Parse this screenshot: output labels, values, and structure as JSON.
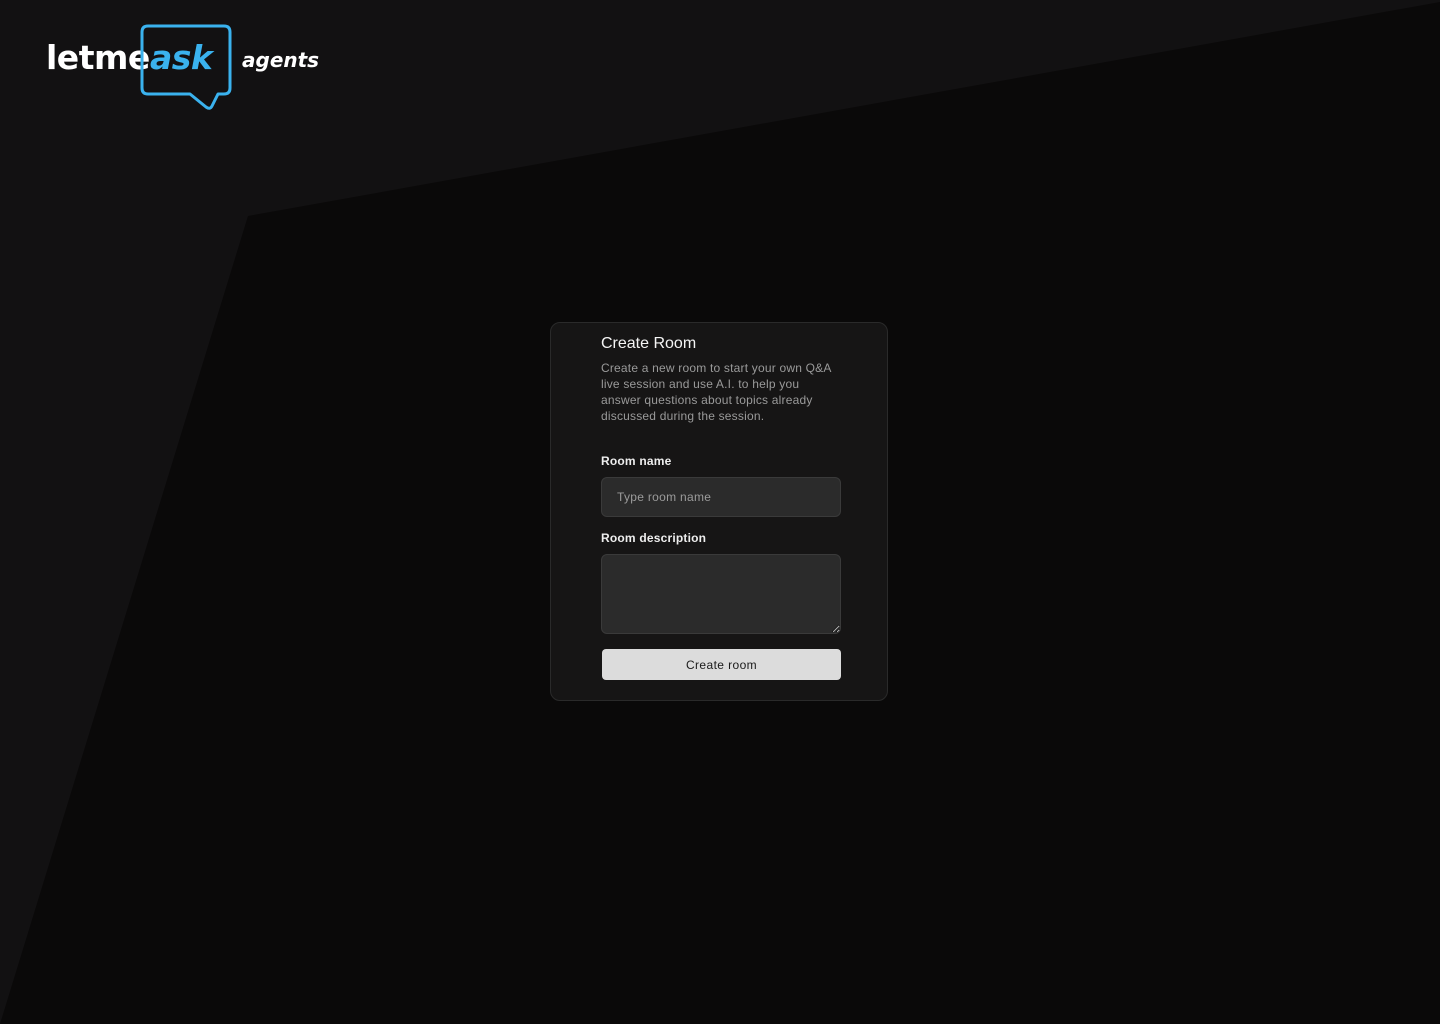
{
  "brand": {
    "logo_part1": "letme",
    "logo_part2": "ask",
    "logo_part3": "agents",
    "accent_color": "#3ab2ee"
  },
  "form": {
    "title": "Create Room",
    "description": "Create a new room to start your own Q&A live session and use A.I. to help you answer questions about topics already discussed during the session.",
    "room_name_label": "Room name",
    "room_name_placeholder": "Type room name",
    "room_name_value": "",
    "room_description_label": "Room description",
    "room_description_value": "",
    "submit_label": "Create room"
  },
  "colors": {
    "background": "#0a0909",
    "background_panel": "#121112",
    "card": "#161515",
    "input": "#2b2b2b",
    "button": "#dcdcdc"
  }
}
